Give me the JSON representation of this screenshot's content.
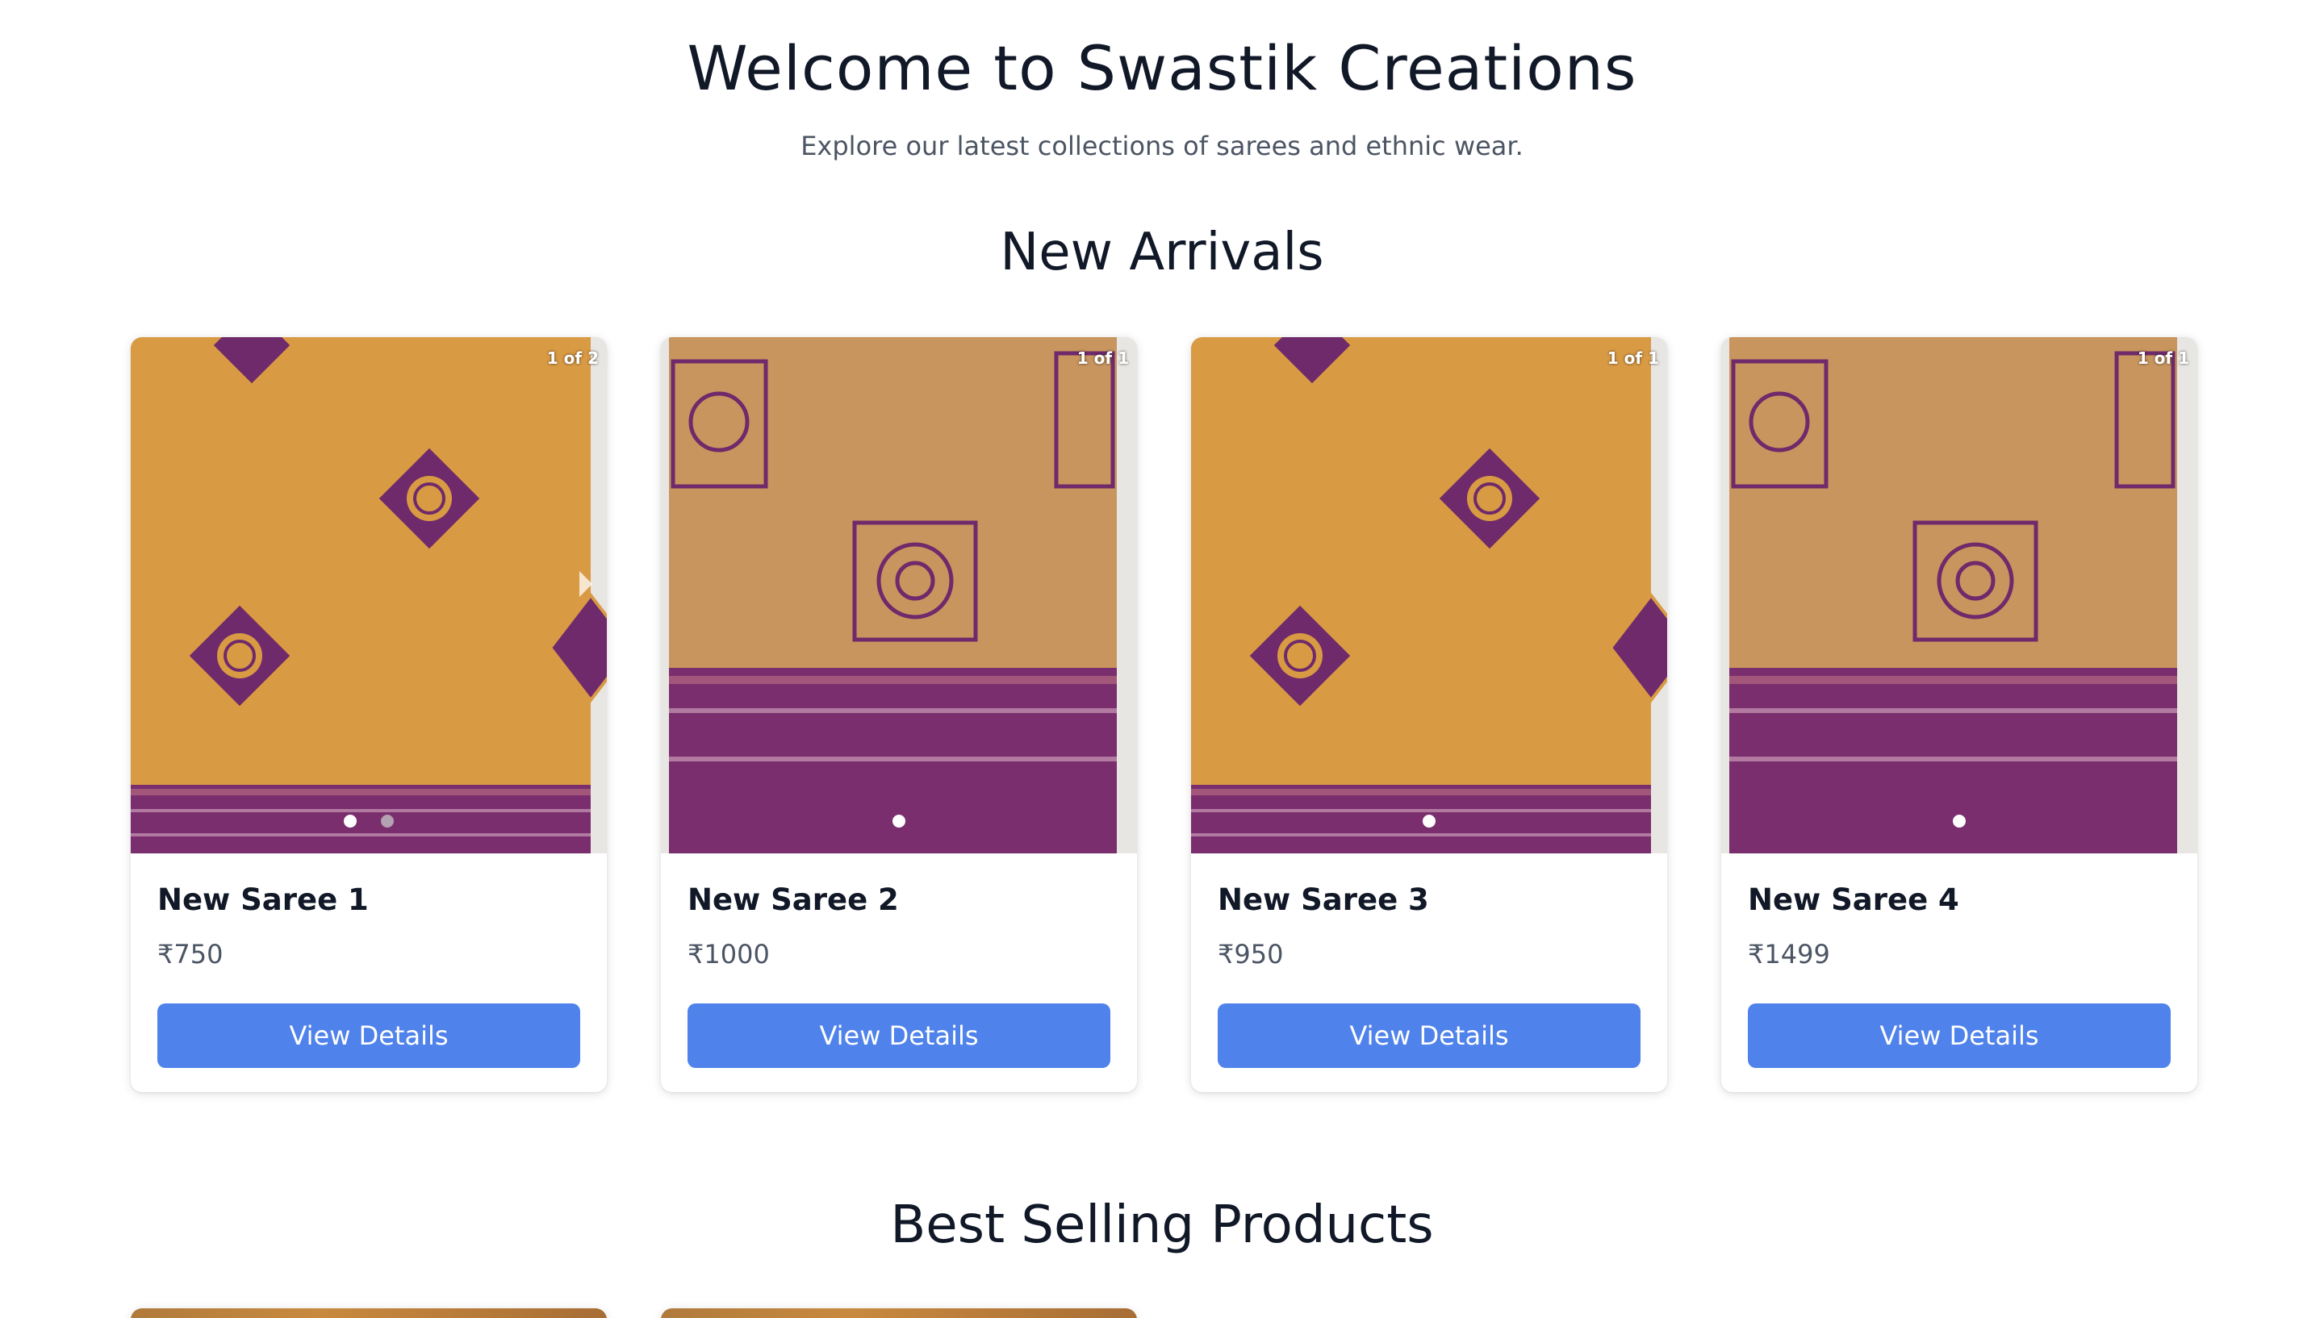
{
  "hero": {
    "title": "Welcome to Swastik Creations",
    "subtitle": "Explore our latest collections of sarees and ethnic wear."
  },
  "sections": {
    "new_arrivals": "New Arrivals",
    "best_selling": "Best Selling Products"
  },
  "products": [
    {
      "name": "New Saree 1",
      "price": "₹750",
      "image_counter": "1 of 2",
      "button": "View Details",
      "pattern": "peacock"
    },
    {
      "name": "New Saree 2",
      "price": "₹1000",
      "image_counter": "1 of 1",
      "button": "View Details",
      "pattern": "mandala"
    },
    {
      "name": "New Saree 3",
      "price": "₹950",
      "image_counter": "1 of 1",
      "button": "View Details",
      "pattern": "peacock"
    },
    {
      "name": "New Saree 4",
      "price": "₹1499",
      "image_counter": "1 of 1",
      "button": "View Details",
      "pattern": "mandala"
    }
  ],
  "colors": {
    "accent": "#4f82ea",
    "saree_body": "#d99a44",
    "saree_border": "#7a2e6e"
  }
}
